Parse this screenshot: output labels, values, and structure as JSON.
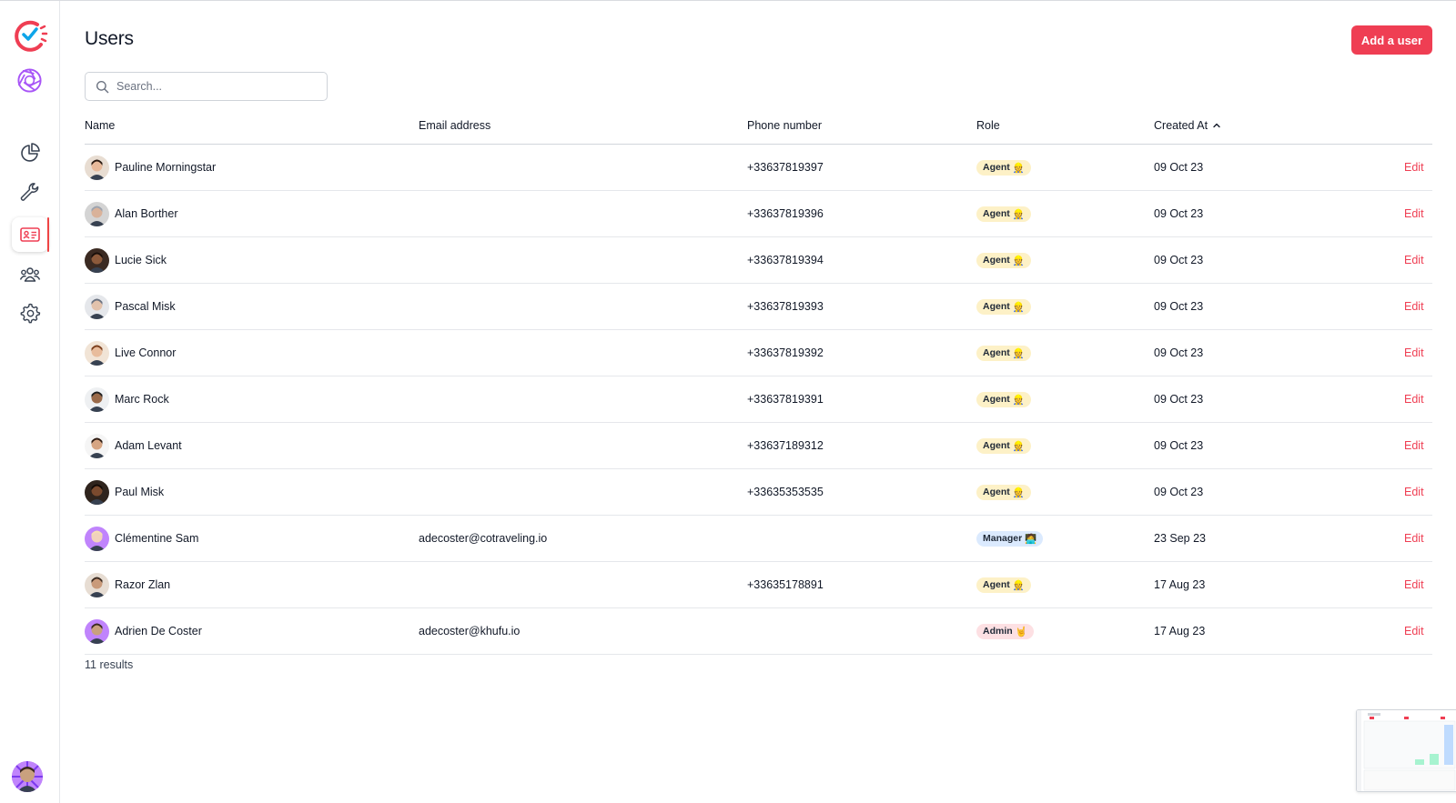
{
  "page": {
    "title": "Users"
  },
  "header": {
    "add_button_label": "Add a user"
  },
  "search": {
    "placeholder": "Search..."
  },
  "table": {
    "columns": {
      "name": "Name",
      "email": "Email address",
      "phone": "Phone number",
      "role": "Role",
      "created_at": "Created At"
    },
    "sort": {
      "column": "created_at",
      "icon": "chevron-up-icon"
    },
    "rows": [
      {
        "name": "Pauline Morningstar",
        "email": "",
        "phone": "+33637819397",
        "role": "Agent",
        "role_emoji": "👷",
        "created": "09 Oct 23",
        "action": "Edit"
      },
      {
        "name": "Alan Borther",
        "email": "",
        "phone": "+33637819396",
        "role": "Agent",
        "role_emoji": "👷",
        "created": "09 Oct 23",
        "action": "Edit"
      },
      {
        "name": "Lucie Sick",
        "email": "",
        "phone": "+33637819394",
        "role": "Agent",
        "role_emoji": "👷",
        "created": "09 Oct 23",
        "action": "Edit"
      },
      {
        "name": "Pascal Misk",
        "email": "",
        "phone": "+33637819393",
        "role": "Agent",
        "role_emoji": "👷",
        "created": "09 Oct 23",
        "action": "Edit"
      },
      {
        "name": "Live Connor",
        "email": "",
        "phone": "+33637819392",
        "role": "Agent",
        "role_emoji": "👷",
        "created": "09 Oct 23",
        "action": "Edit"
      },
      {
        "name": "Marc Rock",
        "email": "",
        "phone": "+33637819391",
        "role": "Agent",
        "role_emoji": "👷",
        "created": "09 Oct 23",
        "action": "Edit"
      },
      {
        "name": "Adam Levant",
        "email": "",
        "phone": "+33637189312",
        "role": "Agent",
        "role_emoji": "👷",
        "created": "09 Oct 23",
        "action": "Edit"
      },
      {
        "name": "Paul Misk",
        "email": "",
        "phone": "+33635353535",
        "role": "Agent",
        "role_emoji": "👷",
        "created": "09 Oct 23",
        "action": "Edit"
      },
      {
        "name": "Clémentine Sam",
        "email": "adecoster@cotraveling.io",
        "phone": "",
        "role": "Manager",
        "role_emoji": "🧑‍💻",
        "created": "23 Sep 23",
        "action": "Edit"
      },
      {
        "name": "Razor Zlan",
        "email": "",
        "phone": "+33635178891",
        "role": "Agent",
        "role_emoji": "👷",
        "created": "17 Aug 23",
        "action": "Edit"
      },
      {
        "name": "Adrien De Coster",
        "email": "adecoster@khufu.io",
        "phone": "",
        "role": "Admin",
        "role_emoji": "🤘",
        "created": "17 Aug 23",
        "action": "Edit"
      }
    ]
  },
  "footer": {
    "results": "11 results"
  },
  "sidebar": {
    "items": [
      {
        "id": "analytics",
        "icon": "pie-chart-icon"
      },
      {
        "id": "tools",
        "icon": "wrench-icon"
      },
      {
        "id": "users",
        "icon": "id-card-icon",
        "active": true
      },
      {
        "id": "teams",
        "icon": "users-group-icon"
      },
      {
        "id": "settings",
        "icon": "gear-icon"
      }
    ]
  },
  "colors": {
    "accent": "#ef3e53",
    "logo_blue": "#0ea5e9",
    "brand_purple": "#a855f7"
  }
}
